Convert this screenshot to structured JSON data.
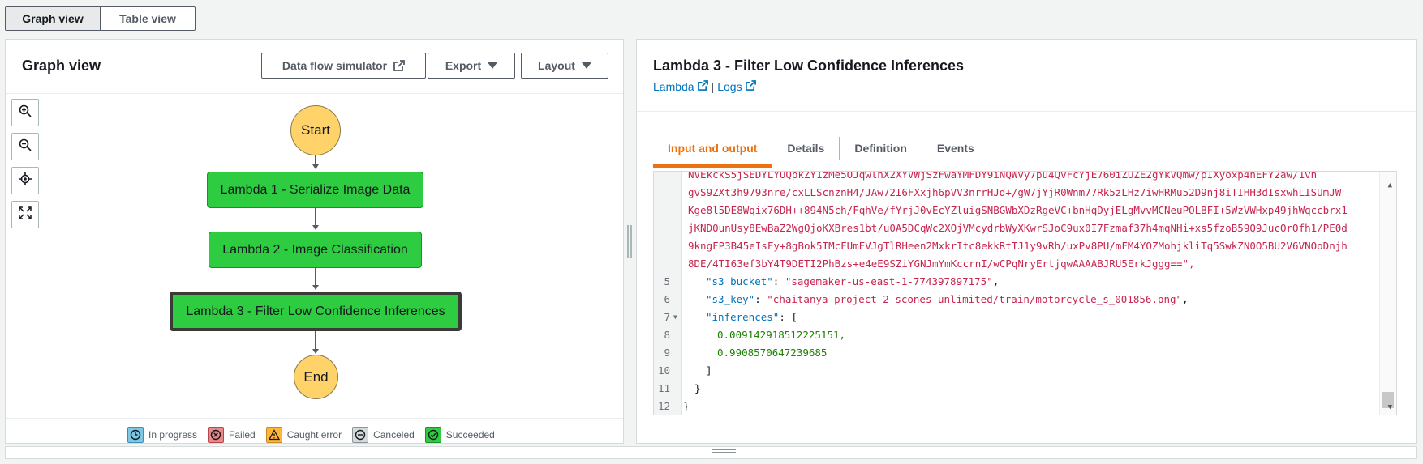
{
  "view_tabs": [
    "Graph view",
    "Table view"
  ],
  "graph": {
    "title": "Graph view",
    "buttons": {
      "simulator": "Data flow simulator",
      "export": "Export",
      "layout": "Layout"
    },
    "nodes": {
      "start": "Start",
      "lambda1": "Lambda 1 - Serialize Image Data",
      "lambda2": "Lambda 2 - Image Classification",
      "lambda3": "Lambda 3 - Filter Low Confidence Inferences",
      "end": "End"
    },
    "legend": [
      "In progress",
      "Failed",
      "Caught error",
      "Canceled",
      "Succeeded"
    ]
  },
  "detail": {
    "title": "Lambda 3 - Filter Low Confidence Inferences",
    "link_lambda": "Lambda",
    "separator": "|",
    "link_logs": "Logs",
    "tabs": [
      "Input and output",
      "Details",
      "Definition",
      "Events"
    ]
  },
  "code": {
    "lines": [
      {
        "n": "",
        "t": "NVEkckS5jSEDYLYUQpkZY1zMe5OJqwlnX2XYVWjSzFwaYMFDY9iNQWvy7pu4QvFcYjE760iZUZE2gYkVQmw/pIXyoxp4nEFY2aw/1vn"
      },
      {
        "n": "",
        "t": "gvS9ZXt3h9793nre/cxLLScnznH4/JAw72I6FXxjh6pVV3nrrHJd+/gW7jYjR0Wnm77Rk5zLHz7iwHRMu52D9nj8iTIHH3dIsxwhLISUmJW"
      },
      {
        "n": "",
        "t": "Kge8l5DE8Wqix76DH++894N5ch/FqhVe/fYrjJ0vEcYZluigSNBGWbXDzRgeVC+bnHqDyjELgMvvMCNeuPOLBFI+5WzVWHxp49jhWqccbrx1"
      },
      {
        "n": "",
        "t": "jKND0unUsy8EwBaZ2WgQjoKXBres1bt/u0A5DCqWc2XOjVMcydrbWyXKwrSJoC9ux0I7Fzmaf37h4mqNHi+xs5fzoB59Q9JucOrOfh1/PE0d"
      },
      {
        "n": "",
        "t": "9kngFP3B45eIsFy+8gBok5IMcFUmEVJgTlRHeen2MxkrItc8ekkRtTJ1y9vRh/uxPv8PU/mFM4YOZMohjkliTq5SwkZN0O5BU2V6VNOoDnjh"
      },
      {
        "n": "",
        "t": "8DE/4TI63ef3bY4T9DETI2PhBzs+e4eE9SZiYGNJmYmKccrnI/wCPqNryErtjqwAAAABJRU5ErkJggg==\","
      },
      {
        "n": "5",
        "k": "s3_bucket",
        "v": "sagemaker-us-east-1-774397897175"
      },
      {
        "n": "6",
        "k": "s3_key",
        "v": "chaitanya-project-2-scones-unlimited/train/motorcycle_s_001856.png"
      },
      {
        "n": "7",
        "k": "inferences"
      },
      {
        "n": "8",
        "num": "0.009142918512225151,"
      },
      {
        "n": "9",
        "num": "0.9908570647239685"
      },
      {
        "n": "10",
        "p": "]"
      },
      {
        "n": "11",
        "p": "}"
      },
      {
        "n": "12",
        "p": "}"
      }
    ]
  }
}
